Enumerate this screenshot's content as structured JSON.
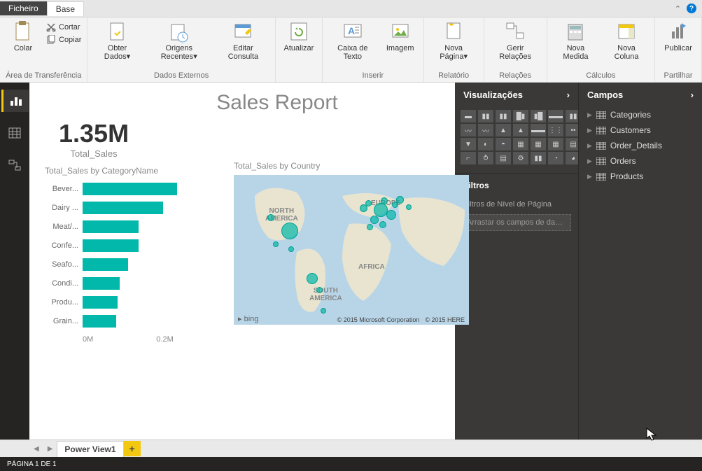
{
  "tabs": {
    "file": "Ficheiro",
    "home": "Base"
  },
  "ribbon": {
    "clipboard": {
      "paste": "Colar",
      "cut": "Cortar",
      "copy": "Copiar",
      "label": "Área de Transferência"
    },
    "external": {
      "get": "Obter Dados",
      "recent": "Origens Recentes",
      "edit": "Editar Consulta",
      "label": "Dados Externos"
    },
    "refresh": "Atualizar",
    "insert": {
      "textbox": "Caixa de Texto",
      "image": "Imagem",
      "label": "Inserir"
    },
    "report": {
      "newpage": "Nova Página",
      "label": "Relatório"
    },
    "relations": {
      "manage": "Gerir Relações",
      "label": "Relações"
    },
    "calc": {
      "measure": "Nova Medida",
      "column": "Nova Coluna",
      "label": "Cálculos"
    },
    "share": {
      "publish": "Publicar",
      "label": "Partilhar"
    }
  },
  "report": {
    "title": "Sales Report",
    "kpi_value": "1.35M",
    "kpi_label": "Total_Sales",
    "bar_title": "Total_Sales by CategoryName",
    "map_title": "Total_Sales by Country",
    "map_bing": "bing",
    "map_copy1": "© 2015 Microsoft Corporation",
    "map_copy2": "© 2015 HERE",
    "continents": {
      "na1": "NORTH",
      "na2": "AMERICA",
      "sa1": "SOUTH",
      "sa2": "AMERICA",
      "eu": "EUROPE",
      "af": "AFRICA"
    }
  },
  "chart_data": {
    "type": "bar",
    "title": "Total_Sales by CategoryName",
    "xlabel": "",
    "ylabel": "",
    "xlim": [
      0,
      0.3
    ],
    "categories": [
      "Bever...",
      "Dairy ...",
      "Meat/...",
      "Confe...",
      "Seafo...",
      "Condi...",
      "Produ...",
      "Grain..."
    ],
    "values": [
      0.27,
      0.23,
      0.16,
      0.16,
      0.13,
      0.105,
      0.1,
      0.095
    ],
    "axis_ticks": [
      "0M",
      "0.2M"
    ]
  },
  "panes": {
    "viz": "Visualizações",
    "fields": "Campos",
    "filters": "Filtros",
    "filter_sub": "Filtros de Nível de Página",
    "filter_drop": "Arrastar os campos de dados...",
    "tables": [
      "Categories",
      "Customers",
      "Order_Details",
      "Orders",
      "Products"
    ]
  },
  "footer": {
    "page_tab": "Power View1",
    "add": "+",
    "status": "PÁGINA 1 DE 1"
  }
}
